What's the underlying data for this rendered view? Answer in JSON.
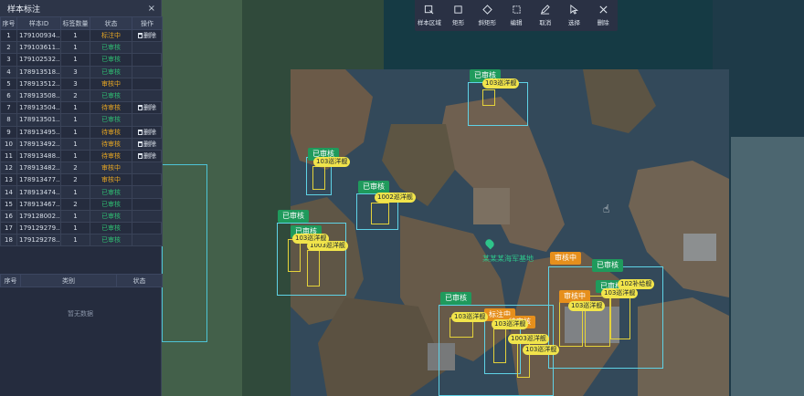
{
  "panel": {
    "title": "样本标注",
    "close_icon": "×",
    "columns": [
      "序号",
      "样本ID",
      "标签数量",
      "状态",
      "操作"
    ],
    "rows": [
      {
        "index": "1",
        "id": "179100934...",
        "count": "1",
        "status": "标注中",
        "status_color": "yellow",
        "action": "删除"
      },
      {
        "index": "2",
        "id": "179103611...",
        "count": "1",
        "status": "已审核",
        "status_color": "green",
        "action": ""
      },
      {
        "index": "3",
        "id": "179102532...",
        "count": "1",
        "status": "已审核",
        "status_color": "green",
        "action": ""
      },
      {
        "index": "4",
        "id": "178913518...",
        "count": "3",
        "status": "已审核",
        "status_color": "green",
        "action": ""
      },
      {
        "index": "5",
        "id": "178913512...",
        "count": "3",
        "status": "审核中",
        "status_color": "yellow",
        "action": ""
      },
      {
        "index": "6",
        "id": "178913508...",
        "count": "2",
        "status": "已审核",
        "status_color": "green",
        "action": ""
      },
      {
        "index": "7",
        "id": "178913504...",
        "count": "1",
        "status": "待审核",
        "status_color": "yellow",
        "action": "删除"
      },
      {
        "index": "8",
        "id": "178913501...",
        "count": "1",
        "status": "已审核",
        "status_color": "green",
        "action": ""
      },
      {
        "index": "9",
        "id": "178913495...",
        "count": "1",
        "status": "待审核",
        "status_color": "yellow",
        "action": "删除"
      },
      {
        "index": "10",
        "id": "178913492...",
        "count": "1",
        "status": "待审核",
        "status_color": "yellow",
        "action": "删除"
      },
      {
        "index": "11",
        "id": "178913488...",
        "count": "1",
        "status": "待审核",
        "status_color": "yellow",
        "action": "删除"
      },
      {
        "index": "12",
        "id": "178913482...",
        "count": "2",
        "status": "审核中",
        "status_color": "yellow",
        "action": ""
      },
      {
        "index": "13",
        "id": "178913477...",
        "count": "2",
        "status": "审核中",
        "status_color": "yellow",
        "action": ""
      },
      {
        "index": "14",
        "id": "178913474...",
        "count": "1",
        "status": "已审核",
        "status_color": "green",
        "action": ""
      },
      {
        "index": "15",
        "id": "178913467...",
        "count": "2",
        "status": "已审核",
        "status_color": "green",
        "action": ""
      },
      {
        "index": "16",
        "id": "179128002...",
        "count": "1",
        "status": "已审核",
        "status_color": "green",
        "action": ""
      },
      {
        "index": "17",
        "id": "179129279...",
        "count": "1",
        "status": "已审核",
        "status_color": "green",
        "action": ""
      },
      {
        "index": "18",
        "id": "179129278...",
        "count": "1",
        "status": "已审核",
        "status_color": "green",
        "action": ""
      }
    ],
    "category_columns": [
      "序号",
      "类别",
      "状态"
    ],
    "empty_text": "暂无数据"
  },
  "toolbar": {
    "tools": [
      {
        "label": "样本区域",
        "icon": "sample-area-icon"
      },
      {
        "label": "矩形",
        "icon": "rectangle-icon"
      },
      {
        "label": "斜矩形",
        "icon": "rotated-rectangle-icon"
      },
      {
        "label": "编辑",
        "icon": "edit-icon"
      },
      {
        "label": "取消",
        "icon": "cancel-pen-icon"
      },
      {
        "label": "选择",
        "icon": "select-cursor-icon"
      },
      {
        "label": "删除",
        "icon": "close-icon"
      }
    ]
  },
  "map": {
    "place_name": "某某某海军基地",
    "tags": {
      "approved": "已审核",
      "in_review": "审核中",
      "labeling": "标注中",
      "pending": "待审核"
    },
    "pills": {
      "p1": "103巡洋舰",
      "p2": "103巡洋舰",
      "p3": "1002巡洋舰",
      "p4": "1003巡洋舰",
      "p5": "103巡洋舰",
      "p6": "103巡洋舰",
      "p7": "103巡洋舰",
      "p8": "1003巡洋舰",
      "p9": "103巡洋舰",
      "p10": "103巡洋舰",
      "p11": "103巡洋舰",
      "p12": "102补给舰"
    },
    "colors": {
      "approved": "#1f9a5c",
      "review": "#e68f1c",
      "box": "#5fd2e6",
      "inner_box": "#e4d23a",
      "pill": "#f1e44b"
    }
  }
}
